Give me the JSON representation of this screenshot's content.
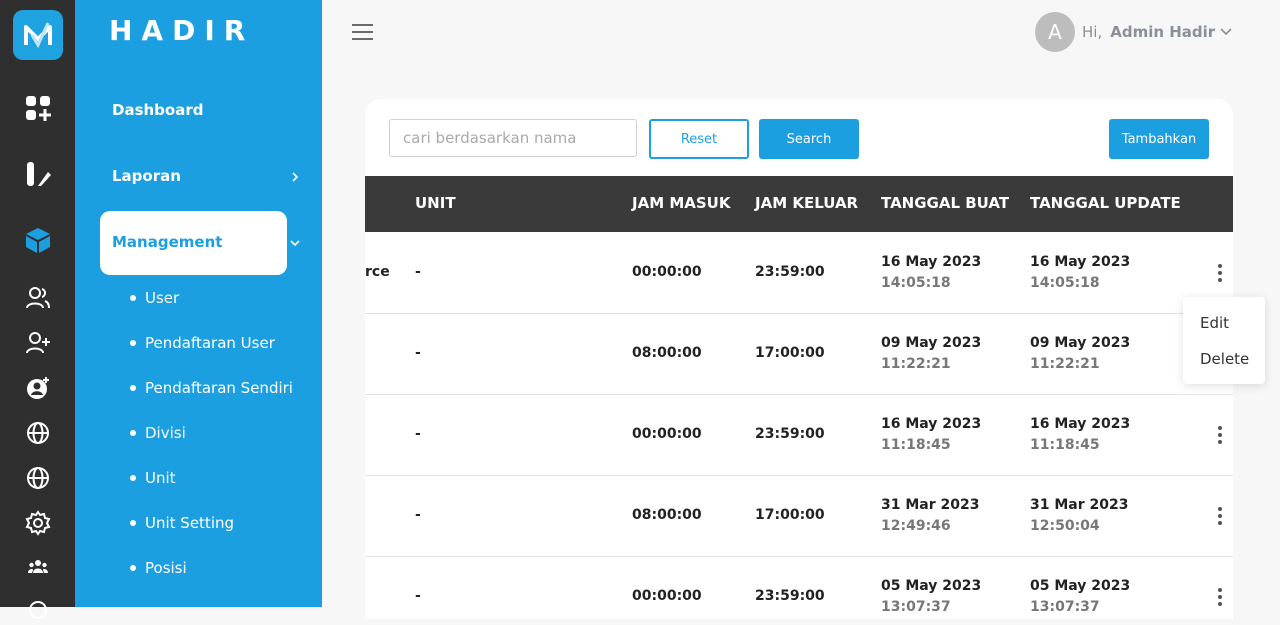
{
  "brand": "HADIR",
  "sidebar": {
    "dashboard": "Dashboard",
    "laporan": "Laporan",
    "management": "Management",
    "sub_items": [
      "User",
      "Pendaftaran User",
      "Pendaftaran Sendiri",
      "Divisi",
      "Unit",
      "Unit Setting",
      "Posisi"
    ]
  },
  "header": {
    "avatar_letter": "A",
    "greeting": "Hi,",
    "user_name": "Admin Hadir"
  },
  "toolbar": {
    "search_placeholder": "cari berdasarkan nama",
    "reset_label": "Reset",
    "search_label": "Search",
    "add_label": "Tambahkan"
  },
  "table": {
    "columns": [
      "UNIT",
      "JAM MASUK",
      "JAM KELUAR",
      "TANGGAL BUAT",
      "TANGGAL UPDATE"
    ],
    "rows": [
      {
        "name_tail": "rce",
        "unit": "-",
        "jam_masuk": "00:00:00",
        "jam_keluar": "23:59:00",
        "buat_date": "16 May 2023",
        "buat_time": "14:05:18",
        "update_date": "16 May 2023",
        "update_time": "14:05:18"
      },
      {
        "name_tail": "",
        "unit": "-",
        "jam_masuk": "08:00:00",
        "jam_keluar": "17:00:00",
        "buat_date": "09 May 2023",
        "buat_time": "11:22:21",
        "update_date": "09 May 2023",
        "update_time": "11:22:21"
      },
      {
        "name_tail": "",
        "unit": "-",
        "jam_masuk": "00:00:00",
        "jam_keluar": "23:59:00",
        "buat_date": "16 May 2023",
        "buat_time": "11:18:45",
        "update_date": "16 May 2023",
        "update_time": "11:18:45"
      },
      {
        "name_tail": "",
        "unit": "-",
        "jam_masuk": "08:00:00",
        "jam_keluar": "17:00:00",
        "buat_date": "31 Mar 2023",
        "buat_time": "12:49:46",
        "update_date": "31 Mar 2023",
        "update_time": "12:50:04"
      },
      {
        "name_tail": "",
        "unit": "-",
        "jam_masuk": "00:00:00",
        "jam_keluar": "23:59:00",
        "buat_date": "05 May 2023",
        "buat_time": "13:07:37",
        "update_date": "05 May 2023",
        "update_time": "13:07:37"
      }
    ]
  },
  "row_menu": {
    "edit": "Edit",
    "delete": "Delete"
  },
  "colors": {
    "primary": "#1c9fe0",
    "rail": "#2f2f2f",
    "table_header": "#3a3a3a"
  }
}
